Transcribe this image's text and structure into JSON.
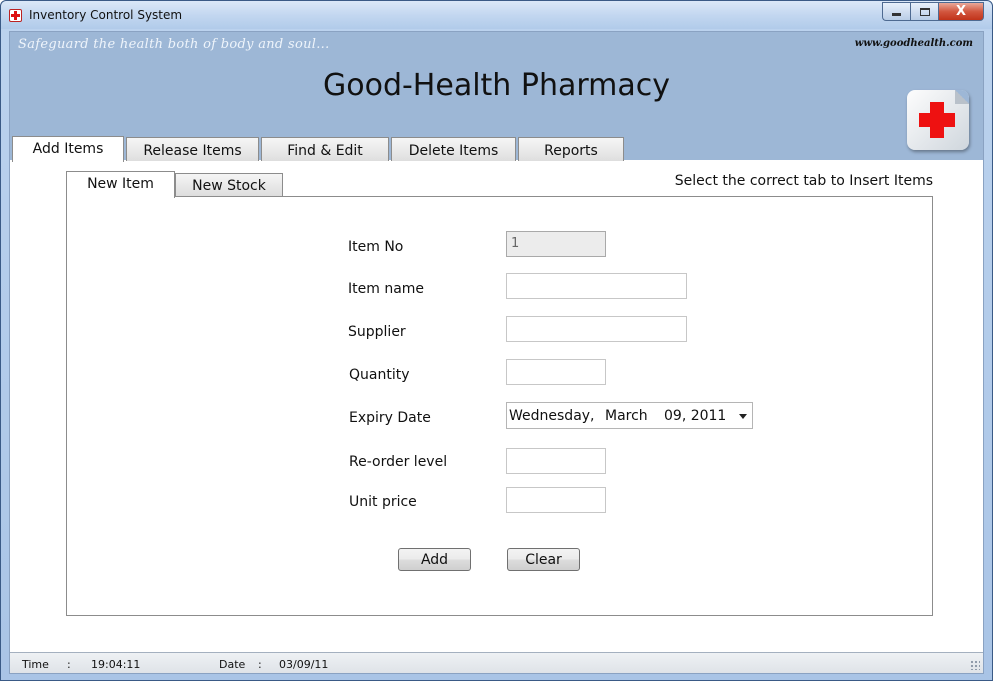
{
  "window": {
    "title": "Inventory Control System",
    "minimize_glyph": "minimize-icon",
    "maximize_glyph": "maximize-icon",
    "close_label": "X"
  },
  "header": {
    "tagline": "Safeguard the health both of body and soul...",
    "website": "www.goodhealth.com",
    "title": "Good-Health Pharmacy",
    "logo_icon": "red-cross-icon",
    "background_color": "#9db7d6",
    "logo_cross_color": "#ee1111"
  },
  "main_tabs": [
    {
      "label": "Add Items",
      "active": true
    },
    {
      "label": "Release Items",
      "active": false
    },
    {
      "label": "Find & Edit",
      "active": false
    },
    {
      "label": "Delete Items",
      "active": false
    },
    {
      "label": "Reports",
      "active": false
    }
  ],
  "sub_tabs": [
    {
      "label": "New Item",
      "active": true
    },
    {
      "label": "New Stock",
      "active": false
    }
  ],
  "hint": "Select the correct tab to Insert Items",
  "form": {
    "item_no": {
      "label": "Item No",
      "value": "1",
      "enabled": false
    },
    "item_name": {
      "label": "Item name",
      "value": ""
    },
    "supplier": {
      "label": "Supplier",
      "value": ""
    },
    "quantity": {
      "label": "Quantity",
      "value": ""
    },
    "expiry_date": {
      "label": "Expiry Date",
      "weekday": "Wednesday,",
      "month": "March",
      "day_year": "09, 2011"
    },
    "reorder_level": {
      "label": "Re-order level",
      "value": ""
    },
    "unit_price": {
      "label": "Unit price",
      "value": ""
    }
  },
  "buttons": {
    "add": "Add",
    "clear": "Clear"
  },
  "status_bar": {
    "time_label": "Time",
    "time_sep": ":",
    "time_value": "19:04:11",
    "date_label": "Date",
    "date_sep": ":",
    "date_value": "03/09/11"
  }
}
